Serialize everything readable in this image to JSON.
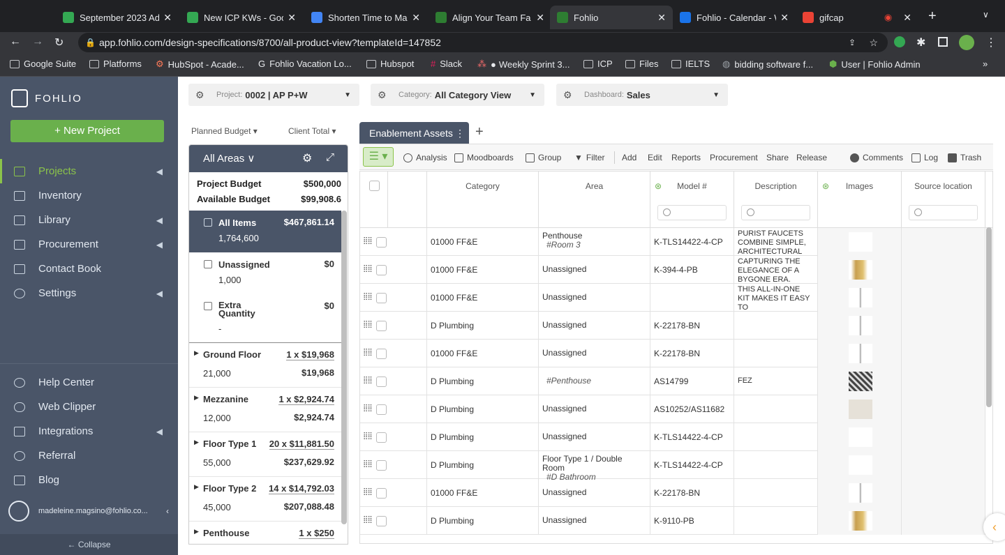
{
  "browser": {
    "tabs": [
      {
        "title": "September 2023 Ad",
        "color": "#34a853"
      },
      {
        "title": "New ICP KWs - Goo",
        "color": "#34a853"
      },
      {
        "title": "Shorten Time to Ma",
        "color": "#4285f4"
      },
      {
        "title": "Align Your Team Fa",
        "color": "#2e7d32"
      },
      {
        "title": "Fohlio",
        "color": "#2e7d32"
      },
      {
        "title": "Fohlio - Calendar - W",
        "color": "#1a73e8"
      },
      {
        "title": "gifcap",
        "color": "#ea4335"
      }
    ],
    "url": "app.fohlio.com/design-specifications/8700/all-product-view?templateId=147852",
    "bookmarks": [
      "Google Suite",
      "Platforms",
      "HubSpot - Acade...",
      "Fohlio Vacation Lo...",
      "Hubspot",
      "Slack",
      "Weekly Sprint 3...",
      "ICP",
      "Files",
      "IELTS",
      "bidding software f...",
      "User | Fohlio Admin"
    ]
  },
  "sidebar": {
    "brand": "FOHLIO",
    "new_project": "+ New Project",
    "items": [
      {
        "label": "Projects",
        "chev": "◀"
      },
      {
        "label": "Inventory",
        "chev": ""
      },
      {
        "label": "Library",
        "chev": "◀"
      },
      {
        "label": "Procurement",
        "chev": "◀"
      },
      {
        "label": "Contact Book",
        "chev": ""
      },
      {
        "label": "Settings",
        "chev": "◀"
      }
    ],
    "bottom_items": [
      {
        "label": "Help Center",
        "chev": ""
      },
      {
        "label": "Web Clipper",
        "chev": ""
      },
      {
        "label": "Integrations",
        "chev": "◀"
      },
      {
        "label": "Referral",
        "chev": ""
      },
      {
        "label": "Blog",
        "chev": ""
      }
    ],
    "user": "madeleine.magsino@fohlio.co...",
    "collapse": "← Collapse"
  },
  "header": {
    "project_label": "Project:",
    "project_value": "0002 | AP P+W",
    "category_label": "Category:",
    "category_value": "All Category View",
    "dashboard_label": "Dashboard:",
    "dashboard_value": "Sales"
  },
  "budget_panel": {
    "planned_budget": "Planned Budget ▾",
    "client_total": "Client Total ▾",
    "area_title": "All Areas ∨",
    "project_budget_label": "Project Budget",
    "project_budget_value": "$500,000",
    "available_budget_label": "Available Budget",
    "available_budget_value": "$99,908.6",
    "items": [
      {
        "name": "All Items",
        "value": "$467,861.14",
        "sub": "1,764,600"
      },
      {
        "name": "Unassigned",
        "value": "$0",
        "sub": "1,000"
      },
      {
        "name": "Extra Quantity",
        "value": "$0",
        "sub": "-"
      }
    ],
    "floors": [
      {
        "name": "Ground Floor",
        "count": "1 x $19,968",
        "qty": "21,000",
        "total": "$19,968"
      },
      {
        "name": "Mezzanine",
        "count": "1 x $2,924.74",
        "qty": "12,000",
        "total": "$2,924.74"
      },
      {
        "name": "Floor Type 1",
        "count": "20 x $11,881.50",
        "qty": "55,000",
        "total": "$237,629.92"
      },
      {
        "name": "Floor Type 2",
        "count": "14 x $14,792.03",
        "qty": "45,000",
        "total": "$207,088.48"
      },
      {
        "name": "Penthouse",
        "count": "1 x $250",
        "qty": "",
        "total": ""
      }
    ]
  },
  "view_tab": "Enablement Assets",
  "toolbar": {
    "left": [
      "Analysis",
      "Moodboards",
      "Group",
      "Filter"
    ],
    "actions": [
      "Add",
      "Edit",
      "Reports",
      "Procurement",
      "Share",
      "Release"
    ],
    "right": [
      "Comments",
      "Log",
      "Trash"
    ]
  },
  "table": {
    "columns": [
      "Category",
      "Area",
      "Model #",
      "Description",
      "Images",
      "Source location"
    ],
    "rows": [
      {
        "category": "01000 FF&E",
        "area": "Penthouse",
        "area_sub": "#Room 3",
        "model": "K-TLS14422-4-CP",
        "desc": "PURIST FAUCETS COMBINE SIMPLE, ARCHITECTURAL",
        "img": "faucet"
      },
      {
        "category": "01000 FF&E",
        "area": "Unassigned",
        "area_sub": "",
        "model": "K-394-4-PB",
        "desc": "CAPTURING THE ELEGANCE OF A BYGONE ERA.",
        "img": "brass"
      },
      {
        "category": "01000 FF&E",
        "area": "Unassigned",
        "area_sub": "",
        "model": "",
        "desc": "THIS ALL-IN-ONE KIT MAKES IT EASY TO",
        "img": "shower"
      },
      {
        "category": "D Plumbing",
        "area": "Unassigned",
        "area_sub": "",
        "model": "K-22178-BN",
        "desc": "",
        "img": "shower"
      },
      {
        "category": "01000 FF&E",
        "area": "Unassigned",
        "area_sub": "",
        "model": "K-22178-BN",
        "desc": "",
        "img": "shower"
      },
      {
        "category": "D Plumbing",
        "area": "",
        "area_sub": "#Penthouse",
        "model": "AS14799",
        "desc": "FEZ",
        "img": "tile"
      },
      {
        "category": "D Plumbing",
        "area": "Unassigned",
        "area_sub": "",
        "model": "AS10252/AS11682",
        "desc": "",
        "img": "stone"
      },
      {
        "category": "D Plumbing",
        "area": "Unassigned",
        "area_sub": "",
        "model": "K-TLS14422-4-CP",
        "desc": "",
        "img": "faucet"
      },
      {
        "category": "D Plumbing",
        "area": "Floor Type 1 / Double Room",
        "area_sub": "#D Bathroom",
        "model": "K-TLS14422-4-CP",
        "desc": "",
        "img": "faucet"
      },
      {
        "category": "01000 FF&E",
        "area": "Unassigned",
        "area_sub": "",
        "model": "K-22178-BN",
        "desc": "",
        "img": "shower"
      },
      {
        "category": "D Plumbing",
        "area": "Unassigned",
        "area_sub": "",
        "model": "K-9110-PB",
        "desc": "",
        "img": "brass"
      }
    ]
  },
  "colors": {
    "accent": "#6ab04c",
    "sidebar": "#4a5568"
  }
}
